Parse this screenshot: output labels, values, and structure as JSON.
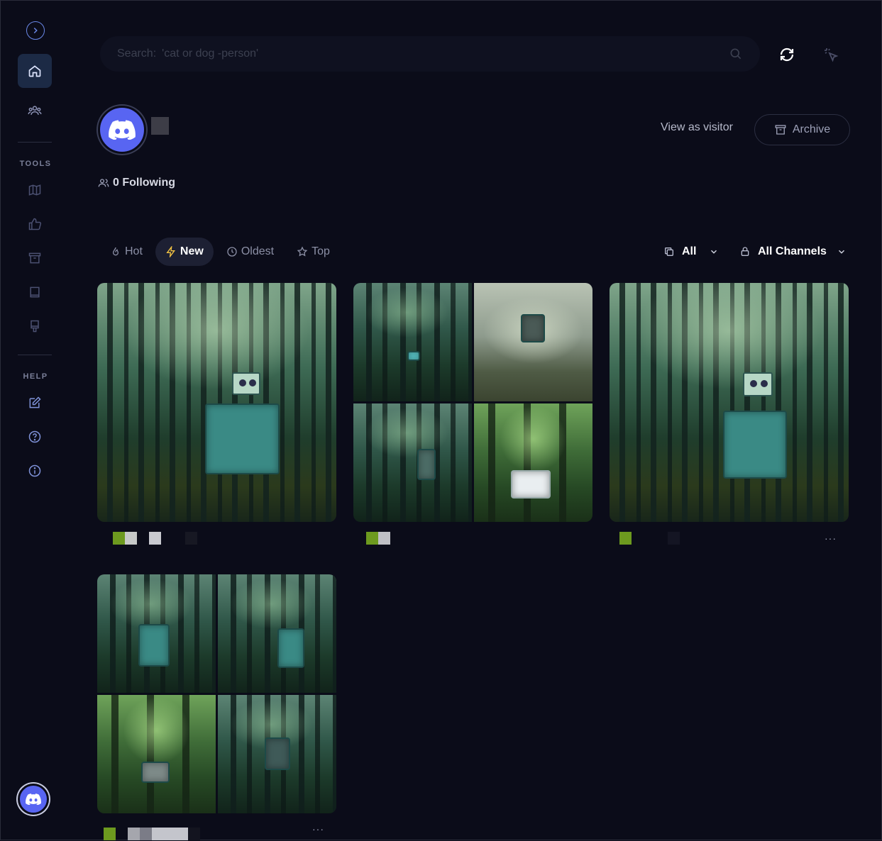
{
  "search": {
    "placeholder_label": "Search:",
    "placeholder_query": "'cat or dog -person'"
  },
  "profile": {
    "following_count": "0 Following",
    "view_as_visitor": "View as visitor",
    "archive": "Archive"
  },
  "sidebar": {
    "tools_label": "TOOLS",
    "help_label": "HELP"
  },
  "sort_tabs": [
    {
      "label": "Hot",
      "icon": "fire-icon",
      "active": false
    },
    {
      "label": "New",
      "icon": "bolt-icon",
      "active": true
    },
    {
      "label": "Oldest",
      "icon": "clock-icon",
      "active": false
    },
    {
      "label": "Top",
      "icon": "star-icon",
      "active": false
    }
  ],
  "filters": {
    "type": "All",
    "channels": "All Channels"
  },
  "colors": {
    "background": "#0b0c19",
    "accent": "#5865f2",
    "active_nav": "#1c2a45",
    "new_icon": "#f4c443"
  }
}
